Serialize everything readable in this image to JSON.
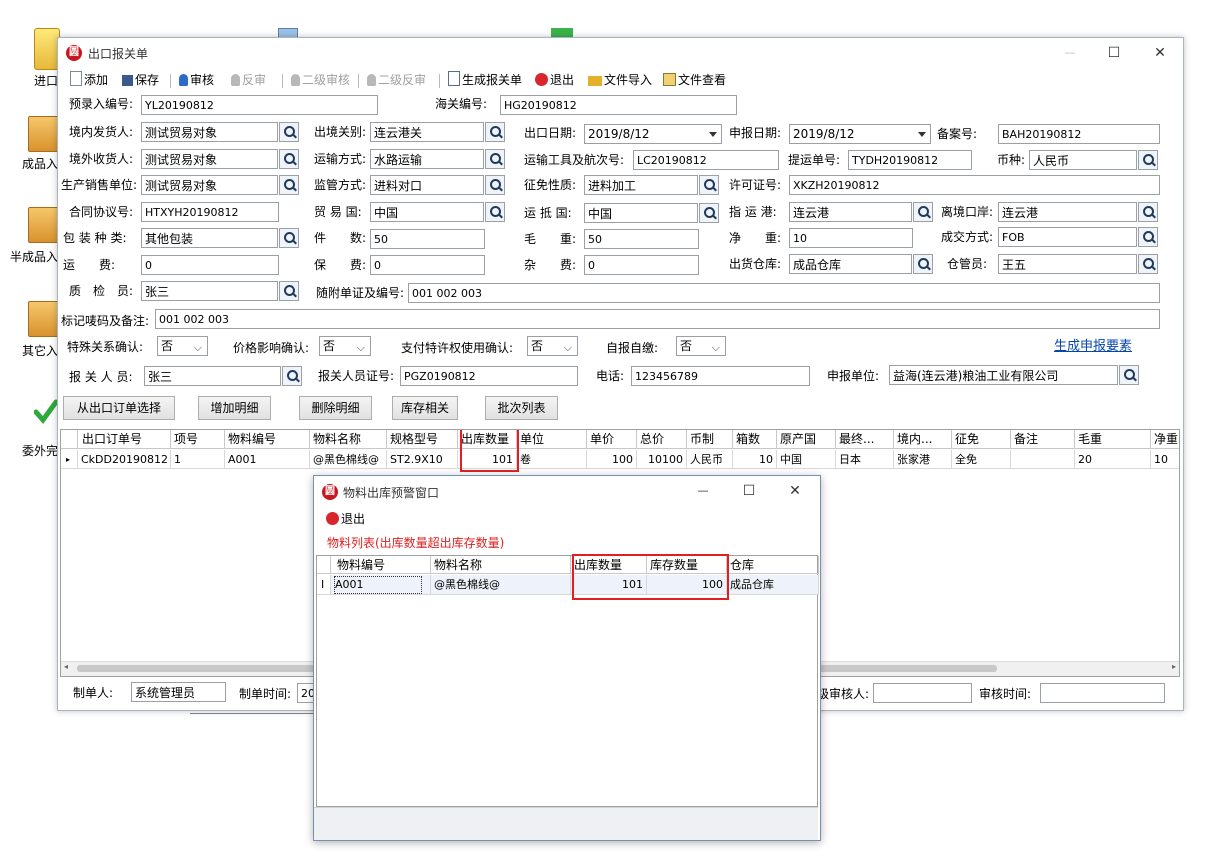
{
  "desktop": {
    "icons": [
      {
        "label": "进口",
        "icon": "clipboard-icon"
      },
      {
        "label": "成品入",
        "icon": "box-icon"
      },
      {
        "label": "半成品入",
        "icon": "box-icon"
      },
      {
        "label": "其它入",
        "icon": "box-icon"
      },
      {
        "label": "委外完",
        "icon": "check-icon"
      }
    ]
  },
  "window": {
    "title": "出口报关单",
    "logo": "圆",
    "controls": {
      "minimize": "—",
      "maximize": "☐",
      "close": "✕"
    }
  },
  "toolbar": {
    "add": "添加",
    "save": "保存",
    "audit": "审核",
    "unaudit": "反审",
    "audit2": "二级审核",
    "unaudit2": "二级反审",
    "gen_declaration": "生成报关单",
    "exit": "退出",
    "import_file": "文件导入",
    "view_file": "文件查看"
  },
  "form": {
    "pre_entry_no_label": "预录入编号:",
    "pre_entry_no": "YL20190812",
    "customs_no_label": "海关编号:",
    "customs_no": "HG20190812",
    "domestic_shipper_label": "境内发货人:",
    "domestic_shipper": "测试贸易对象",
    "exit_customs_label": "出境关别:",
    "exit_customs": "连云港关",
    "export_date_label": "出口日期:",
    "export_date": "2019/8/12",
    "declare_date_label": "申报日期:",
    "declare_date": "2019/8/12",
    "record_no_label": "备案号:",
    "record_no": "BAH20190812",
    "overseas_consignee_label": "境外收货人:",
    "overseas_consignee": "测试贸易对象",
    "transport_mode_label": "运输方式:",
    "transport_mode": "水路运输",
    "vessel_voyage_label": "运输工具及航次号:",
    "vessel_voyage": "LC20190812",
    "bill_no_label": "提运单号:",
    "bill_no": "TYDH20190812",
    "currency_label": "币种:",
    "currency": "人民币",
    "producer_label": "生产销售单位:",
    "producer": "测试贸易对象",
    "supervision_label": "监管方式:",
    "supervision": "进料对口",
    "tax_nature_label": "征免性质:",
    "tax_nature": "进料加工",
    "license_label": "许可证号:",
    "license": "XKZH20190812",
    "contract_label": "合同协议号:",
    "contract": "HTXYH20190812",
    "trade_country_label": "贸 易 国:",
    "trade_country": "中国",
    "dest_country_label": "运 抵 国:",
    "dest_country": "中国",
    "dest_port_label": "指 运 港:",
    "dest_port": "连云港",
    "departure_port_label": "离境口岸:",
    "departure_port": "连云港",
    "package_type_label": "包 装 种 类:",
    "package_type": "其他包装",
    "pieces_label": "件　　数:",
    "pieces": "50",
    "gross_weight_label": "毛　　重:",
    "gross_weight": "50",
    "net_weight_label": "净　　重:",
    "net_weight": "10",
    "deal_mode_label": "成交方式:",
    "deal_mode": "FOB",
    "freight_label": "运　　费:",
    "freight": "0",
    "insurance_label": "保　　费:",
    "insurance": "0",
    "misc_fee_label": "杂　　费:",
    "misc_fee": "0",
    "ship_warehouse_label": "出货仓库:",
    "ship_warehouse": "成品仓库",
    "keeper_label": "仓管员:",
    "keeper": "王五",
    "inspector_label": "质　检　员:",
    "inspector": "张三",
    "attached_docs_label": "随附单证及编号:",
    "attached_docs": "001 002 003",
    "marks_label": "标记唛码及备注:",
    "marks": "001 002 003",
    "special_rel_label": "特殊关系确认:",
    "special_rel": "否",
    "price_effect_label": "价格影响确认:",
    "price_effect": "否",
    "royalty_label": "支付特许权使用确认:",
    "royalty": "否",
    "self_report_label": "自报自缴:",
    "self_report": "否",
    "gen_elements_link": "生成申报要素",
    "declarer_label": "报 关 人 员:",
    "declarer": "张三",
    "declarer_cert_label": "报关人员证号:",
    "declarer_cert": "PGZ0190812",
    "phone_label": "电话:",
    "phone": "123456789",
    "declare_unit_label": "申报单位:",
    "declare_unit": "益海(连云港)粮油工业有限公司"
  },
  "buttons": {
    "from_order": "从出口订单选择",
    "add_detail": "增加明细",
    "delete_detail": "删除明细",
    "inventory": "库存相关",
    "batch_list": "批次列表"
  },
  "grid": {
    "headers": [
      "出口订单号",
      "项号",
      "物料编号",
      "物料名称",
      "规格型号",
      "出库数量",
      "单位",
      "单价",
      "总价",
      "币制",
      "箱数",
      "原产国",
      "最终...",
      "境内...",
      "征免",
      "备注",
      "毛重",
      "净重"
    ],
    "rows": [
      [
        "CkDD20190812",
        "1",
        "A001",
        "@黑色棉线@",
        "ST2.9X10",
        "101",
        "卷",
        "100",
        "10100",
        "人民币",
        "10",
        "中国",
        "日本",
        "张家港",
        "全免",
        "",
        "20",
        "10"
      ]
    ]
  },
  "footer": {
    "maker_label": "制单人:",
    "maker": "系统管理员",
    "make_time_label": "制单时间:",
    "make_time": "20",
    "auditor_label": "级审核人:",
    "auditor": "",
    "audit_time_label": "审核时间:",
    "audit_time": ""
  },
  "popup": {
    "title": "物料出库预警窗口",
    "exit": "退出",
    "caption": "物料列表(出库数量超出库存数量)",
    "headers": [
      "物料编号",
      "物料名称",
      "出库数量",
      "库存数量",
      "仓库"
    ],
    "rows": [
      [
        "A001",
        "@黑色棉线@",
        "101",
        "100",
        "成品仓库"
      ]
    ],
    "row_indicator": "I"
  },
  "colors": {
    "accent_red": "#e02020",
    "link": "#0645ad",
    "caption_red": "#e02020",
    "logo": "#c8161d"
  }
}
